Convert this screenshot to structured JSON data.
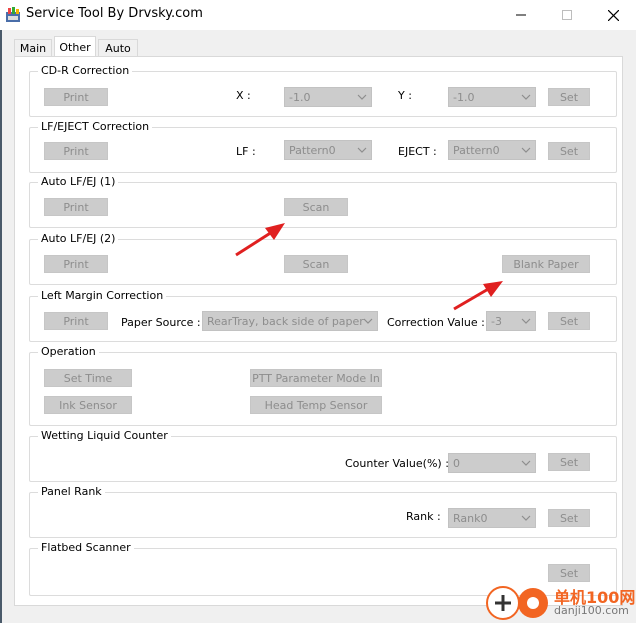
{
  "window": {
    "title": "Service Tool By Drvsky.com"
  },
  "tabs": [
    "Main",
    "Other",
    "Auto"
  ],
  "cdr": {
    "title": "CD-R Correction",
    "print": "Print",
    "x_label": "X :",
    "x_value": "-1.0",
    "y_label": "Y :",
    "y_value": "-1.0",
    "set": "Set"
  },
  "lfeject": {
    "title": "LF/EJECT Correction",
    "print": "Print",
    "lf_label": "LF :",
    "lf_value": "Pattern0",
    "eject_label": "EJECT :",
    "eject_value": "Pattern0",
    "set": "Set"
  },
  "auto1": {
    "title": "Auto LF/EJ (1)",
    "print": "Print",
    "scan": "Scan"
  },
  "auto2": {
    "title": "Auto LF/EJ (2)",
    "print": "Print",
    "scan": "Scan",
    "blank": "Blank Paper"
  },
  "leftmargin": {
    "title": "Left Margin Correction",
    "print": "Print",
    "source_label": "Paper Source :",
    "source_value": "RearTray, back side of paper",
    "corr_label": "Correction Value :",
    "corr_value": "-3",
    "set": "Set"
  },
  "operation": {
    "title": "Operation",
    "set_time": "Set Time",
    "ptt": "PTT Parameter Mode In",
    "ink": "Ink Sensor",
    "head": "Head Temp Sensor"
  },
  "wetting": {
    "title": "Wetting Liquid Counter",
    "label": "Counter Value(%) :",
    "value": "0",
    "set": "Set"
  },
  "panel": {
    "title": "Panel Rank",
    "label": "Rank :",
    "value": "Rank0",
    "set": "Set"
  },
  "flatbed": {
    "title": "Flatbed Scanner",
    "set": "Set"
  },
  "watermark": {
    "cn": "单机100网",
    "en": "danji100.com"
  },
  "colors": {
    "accent": "#f26522",
    "arrow": "#e02020"
  }
}
